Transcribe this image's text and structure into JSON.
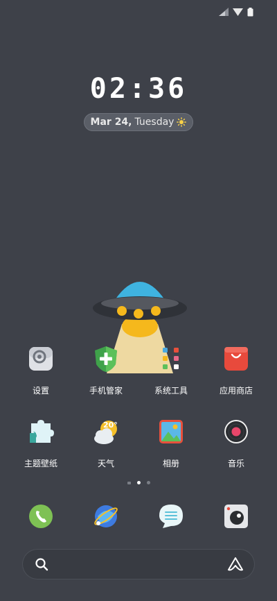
{
  "clock": {
    "time": "02:36"
  },
  "date": {
    "month_day": "Mar 24,",
    "weekday": "Tuesday",
    "weather_icon": "sun-icon"
  },
  "apps_row1": [
    {
      "label": "设置",
      "icon": "gear-icon"
    },
    {
      "label": "手机管家",
      "icon": "shield-icon"
    },
    {
      "label": "系统工具",
      "icon": "tools-grid-icon"
    },
    {
      "label": "应用商店",
      "icon": "store-bag-icon"
    }
  ],
  "apps_row2": [
    {
      "label": "主题壁纸",
      "icon": "puzzle-icon"
    },
    {
      "label": "天气",
      "icon": "weather-icon",
      "temp": "20°"
    },
    {
      "label": "相册",
      "icon": "gallery-icon"
    },
    {
      "label": "音乐",
      "icon": "music-record-icon"
    }
  ],
  "dock": [
    {
      "icon": "phone-icon"
    },
    {
      "icon": "browser-planet-icon"
    },
    {
      "icon": "messages-icon"
    },
    {
      "icon": "camera-icon"
    }
  ],
  "pages": {
    "count": 3,
    "active": 2
  },
  "colors": {
    "background": "#3e4149",
    "ufo_blue": "#3fb3e0",
    "ufo_yellow": "#f5b81c",
    "store_red": "#e84a3c"
  }
}
